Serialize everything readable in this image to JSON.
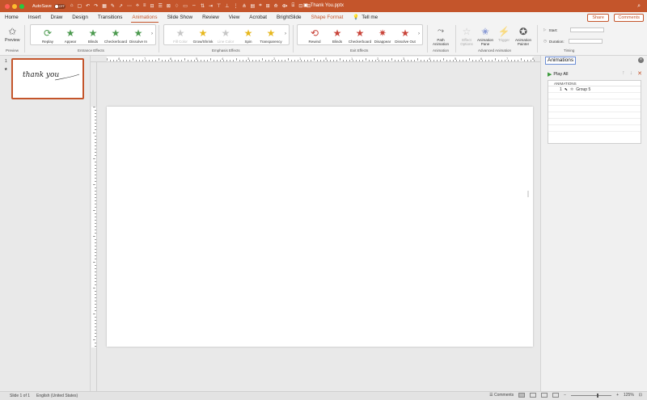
{
  "titlebar": {
    "autosave_label": "AutoSave",
    "autosave_state": "OFF",
    "doc_title": "Thank You.pptx",
    "qat_glyphs": [
      "⌂",
      "▢",
      "↶",
      "↷",
      "▦",
      "✎",
      "↗",
      "⋯",
      "⟡",
      "≡",
      "⊟",
      "☰",
      "⊠",
      "♢",
      "▭",
      "⇔",
      "⇅",
      "⇥",
      "⊤",
      "⊥",
      "⋮",
      "⋔",
      "▤",
      "⌗",
      "⊞",
      "⟰",
      "⟴",
      "⌸",
      "⊡",
      "⊟"
    ]
  },
  "tabs": [
    "Home",
    "Insert",
    "Draw",
    "Design",
    "Transitions",
    "Animations",
    "Slide Show",
    "Review",
    "View",
    "Acrobat",
    "BrightSlide",
    "Shape Format"
  ],
  "active_tab": "Animations",
  "tell_me": "Tell me",
  "share_label": "Share",
  "comments_label": "Comments",
  "ribbon": {
    "preview": "Preview",
    "preview_group": "Preview",
    "entrance": [
      "Replay",
      "Appear",
      "Blinds",
      "Checkerboard",
      "Dissolve In"
    ],
    "entrance_group": "Entrance Effects",
    "emphasis": [
      "Fill Color",
      "Grow/Shrink",
      "Line Color",
      "Spin",
      "Transparency"
    ],
    "emphasis_group": "Emphasis Effects",
    "exit": [
      "Rewind",
      "Blinds",
      "Checkerboard",
      "Disappear",
      "Dissolve Out"
    ],
    "exit_group": "Exit Effects",
    "path_animation": "Path\nAnimation",
    "animation_group": "Animation",
    "effect_options": "Effect\nOptions",
    "animation_pane": "Animation\nPane",
    "trigger": "Trigger",
    "animation_painter": "Animation\nPainter",
    "advanced_group": "Advanced Animation",
    "start_label": "Start:",
    "duration_label": "Duration:",
    "timing_group": "Timing"
  },
  "thumbnail": {
    "number": "1",
    "text": "thank you"
  },
  "ruler_h": [
    "8",
    "7",
    "6",
    "5",
    "4",
    "3",
    "2",
    "1",
    "0",
    "1",
    "2",
    "3",
    "4",
    "5",
    "6",
    "7",
    "8"
  ],
  "animation_pane": {
    "title": "Animations",
    "play_all": "Play All",
    "list_header": "ANIMATIONS",
    "items": [
      {
        "index": "1",
        "name": "Group 5"
      }
    ]
  },
  "status": {
    "slide_info": "Slide 1 of 1",
    "language": "English (United States)",
    "comments": "Comments",
    "zoom": "125%"
  },
  "colors": {
    "accent": "#c4552b",
    "entrance_star": "#4c9a4f",
    "emphasis_star": "#e7b81f",
    "exit_star": "#c9443a"
  }
}
